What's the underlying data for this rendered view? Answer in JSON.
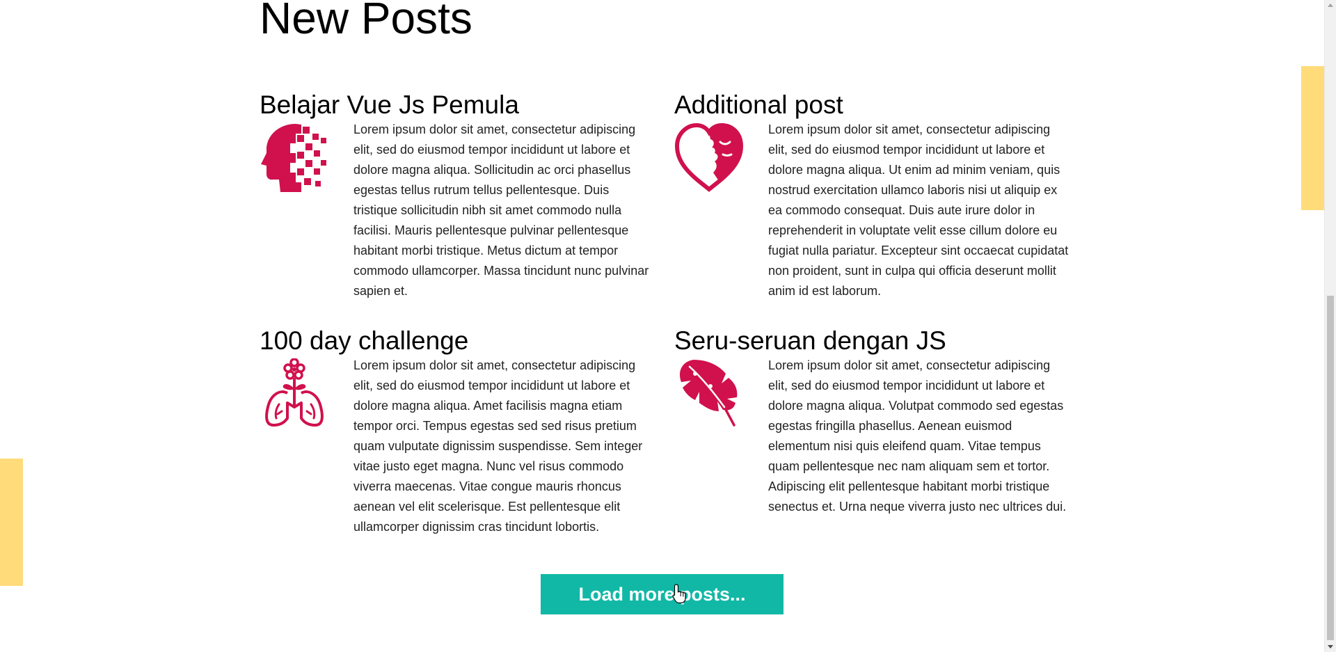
{
  "page": {
    "title": "New Posts"
  },
  "posts": [
    {
      "title": "Belajar Vue Js Pemula",
      "icon": "pixel-head-icon",
      "text": "Lorem ipsum dolor sit amet, consectetur adipiscing elit, sed do eiusmod tempor incididunt ut labore et dolore magna aliqua. Sollicitudin ac orci phasellus egestas tellus rutrum tellus pellentesque. Duis tristique sollicitudin nibh sit amet commodo nulla facilisi. Mauris pellentesque pulvinar pellentesque habitant morbi tristique. Metus dictum at tempor commodo ullamcorper. Massa tincidunt nunc pulvinar sapien et."
    },
    {
      "title": "Additional post",
      "icon": "heart-face-icon",
      "text": "Lorem ipsum dolor sit amet, consectetur adipiscing elit, sed do eiusmod tempor incididunt ut labore et dolore magna aliqua. Ut enim ad minim veniam, quis nostrud exercitation ullamco laboris nisi ut aliquip ex ea commodo consequat. Duis aute irure dolor in reprehenderit in voluptate velit esse cillum dolore eu fugiat nulla pariatur. Excepteur sint occaecat cupidatat non proident, sunt in culpa qui officia deserunt mollit anim id est laborum."
    },
    {
      "title": "100 day challenge",
      "icon": "lungs-flower-icon",
      "text": "Lorem ipsum dolor sit amet, consectetur adipiscing elit, sed do eiusmod tempor incididunt ut labore et dolore magna aliqua. Amet facilisis magna etiam tempor orci. Tempus egestas sed sed risus pretium quam vulputate dignissim suspendisse. Sem integer vitae justo eget magna. Nunc vel risus commodo viverra maecenas. Vitae congue mauris rhoncus aenean vel elit scelerisque. Est pellentesque elit ullamcorper dignissim cras tincidunt lobortis."
    },
    {
      "title": "Seru-seruan dengan JS",
      "icon": "monstera-leaf-icon",
      "text": "Lorem ipsum dolor sit amet, consectetur adipiscing elit, sed do eiusmod tempor incididunt ut labore et dolore magna aliqua. Volutpat commodo sed egestas egestas fringilla phasellus. Aenean euismod elementum nisi quis eleifend quam. Vitae tempus quam pellentesque nec nam aliquam sem et tortor. Adipiscing elit pellentesque habitant morbi tristique senectus et. Urna neque viverra justo nec ultrices dui."
    }
  ],
  "actions": {
    "load_more_label": "Load more posts..."
  },
  "colors": {
    "icon": "#d0114d",
    "button": "#12b8a6",
    "accent_block": "#ffdb7a"
  }
}
